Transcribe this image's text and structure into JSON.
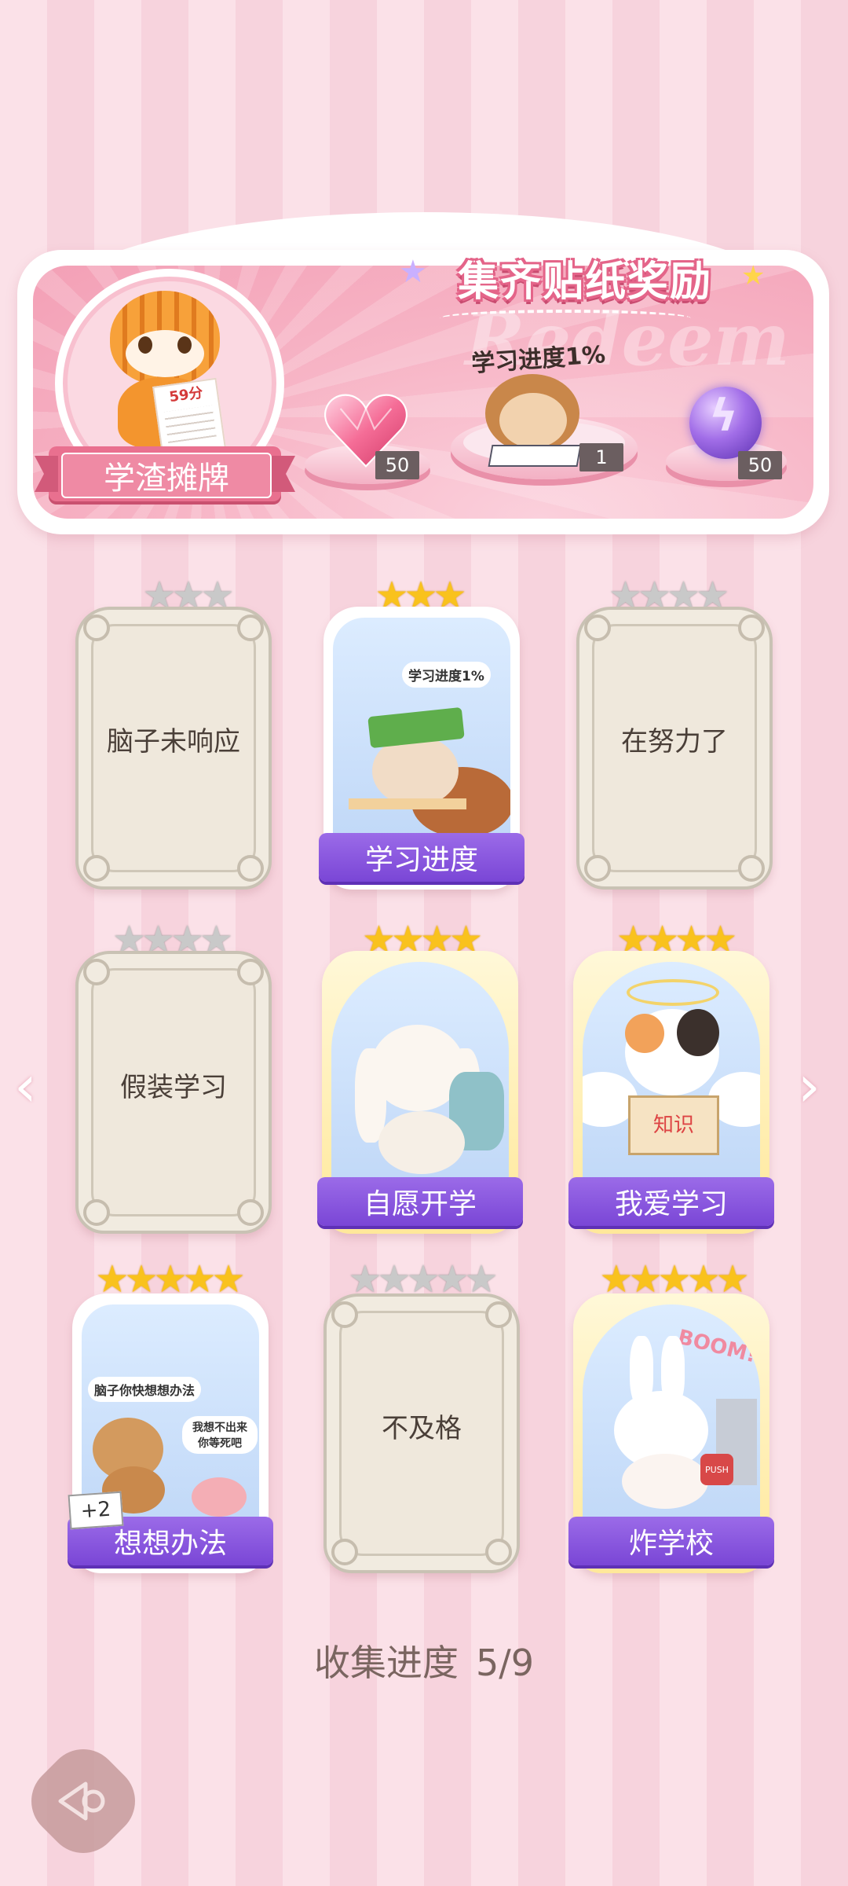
{
  "banner": {
    "title": "集齐贴纸奖励",
    "badge_label": "学渣摊牌",
    "tiger_score": "59分",
    "monkey_caption": "学习进度1%",
    "watermark": "Redeem",
    "rewards": [
      {
        "name": "heart-gem",
        "count": "50"
      },
      {
        "name": "monkey-sticker",
        "count": "1"
      },
      {
        "name": "lightning-orb",
        "count": "50"
      }
    ]
  },
  "stickers": [
    {
      "title": "脑子未响应",
      "stars": 3,
      "unlocked": false
    },
    {
      "title": "学习进度",
      "stars": 3,
      "unlocked": true,
      "caption": "学习进度1%"
    },
    {
      "title": "在努力了",
      "stars": 4,
      "unlocked": false
    },
    {
      "title": "假装学习",
      "stars": 4,
      "unlocked": false
    },
    {
      "title": "自愿开学",
      "stars": 4,
      "unlocked": true
    },
    {
      "title": "我爱学习",
      "stars": 4,
      "unlocked": true,
      "book_text": "知识"
    },
    {
      "title": "想想办法",
      "stars": 5,
      "unlocked": true,
      "bubble1": "脑子你快想想办法",
      "bubble2": "我想不出来你等死吧",
      "extra": "+2"
    },
    {
      "title": "不及格",
      "stars": 5,
      "unlocked": false
    },
    {
      "title": "炸学校",
      "stars": 5,
      "unlocked": true,
      "boom": "BOOM!!",
      "push": "PUSH"
    }
  ],
  "progress": {
    "label": "收集进度",
    "value": "5/9"
  },
  "colors": {
    "accent_pink": "#e9708f",
    "ribbon_purple": "#7a46d6",
    "star_gold": "#f9c21d"
  }
}
